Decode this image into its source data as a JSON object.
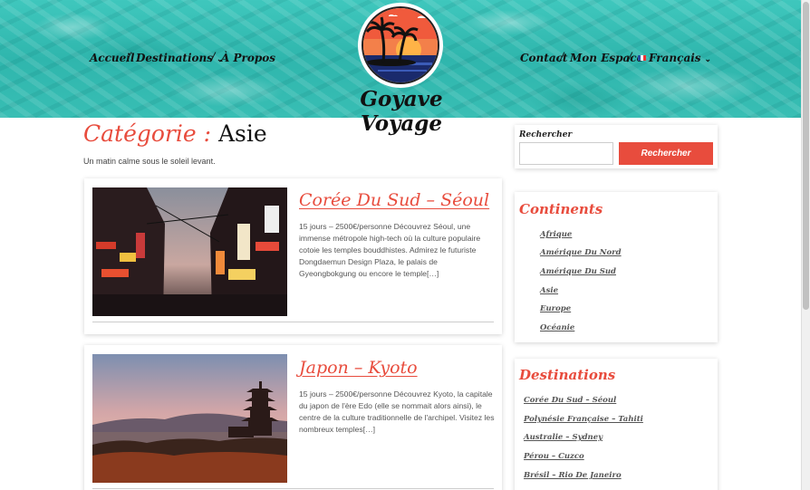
{
  "header": {
    "site_title": "Goyave Voyage",
    "nav_left": [
      "Accueil",
      "Destinations",
      "À Propos"
    ],
    "nav_right": [
      "Contact",
      "Mon Espace",
      "Français"
    ]
  },
  "main": {
    "title_prefix": "Catégorie :",
    "title_category": "Asie",
    "description": "Un matin calme sous le soleil levant.",
    "posts": [
      {
        "title": "Corée Du Sud – Séoul",
        "excerpt": "15 jours – 2500€/personne Découvrez Séoul, une immense métropole high-tech où la culture populaire cotoie les temples bouddhistes. Admirez le futuriste Dongdaemun Design Plaza, le palais de Gyeongbokgung ou encore le temple[…]"
      },
      {
        "title": "Japon – Kyoto",
        "excerpt": "15 jours – 2500€/personne Découvrez Kyoto, la capitale du japon de l'ère Edo (elle se nommait alors ainsi), le centre de la culture traditionnelle de l'archipel. Visitez les nombreux temples[…]"
      }
    ]
  },
  "sidebar": {
    "search_label": "Rechercher",
    "search_button": "Rechercher",
    "search_placeholder": "",
    "continents_title": "Continents",
    "continents": [
      "Afrique",
      "Amérique Du Nord",
      "Amérique Du Sud",
      "Asie",
      "Europe",
      "Océanie"
    ],
    "destinations_title": "Destinations",
    "destinations": [
      "Corée Du Sud – Séoul",
      "Polynésie Française – Tahiti",
      "Australie – Sydney",
      "Pérou – Cuzco",
      "Brésil – Rio De Janeiro"
    ]
  },
  "colors": {
    "accent": "#e84c3d",
    "header_water": "#3fc7bd"
  }
}
